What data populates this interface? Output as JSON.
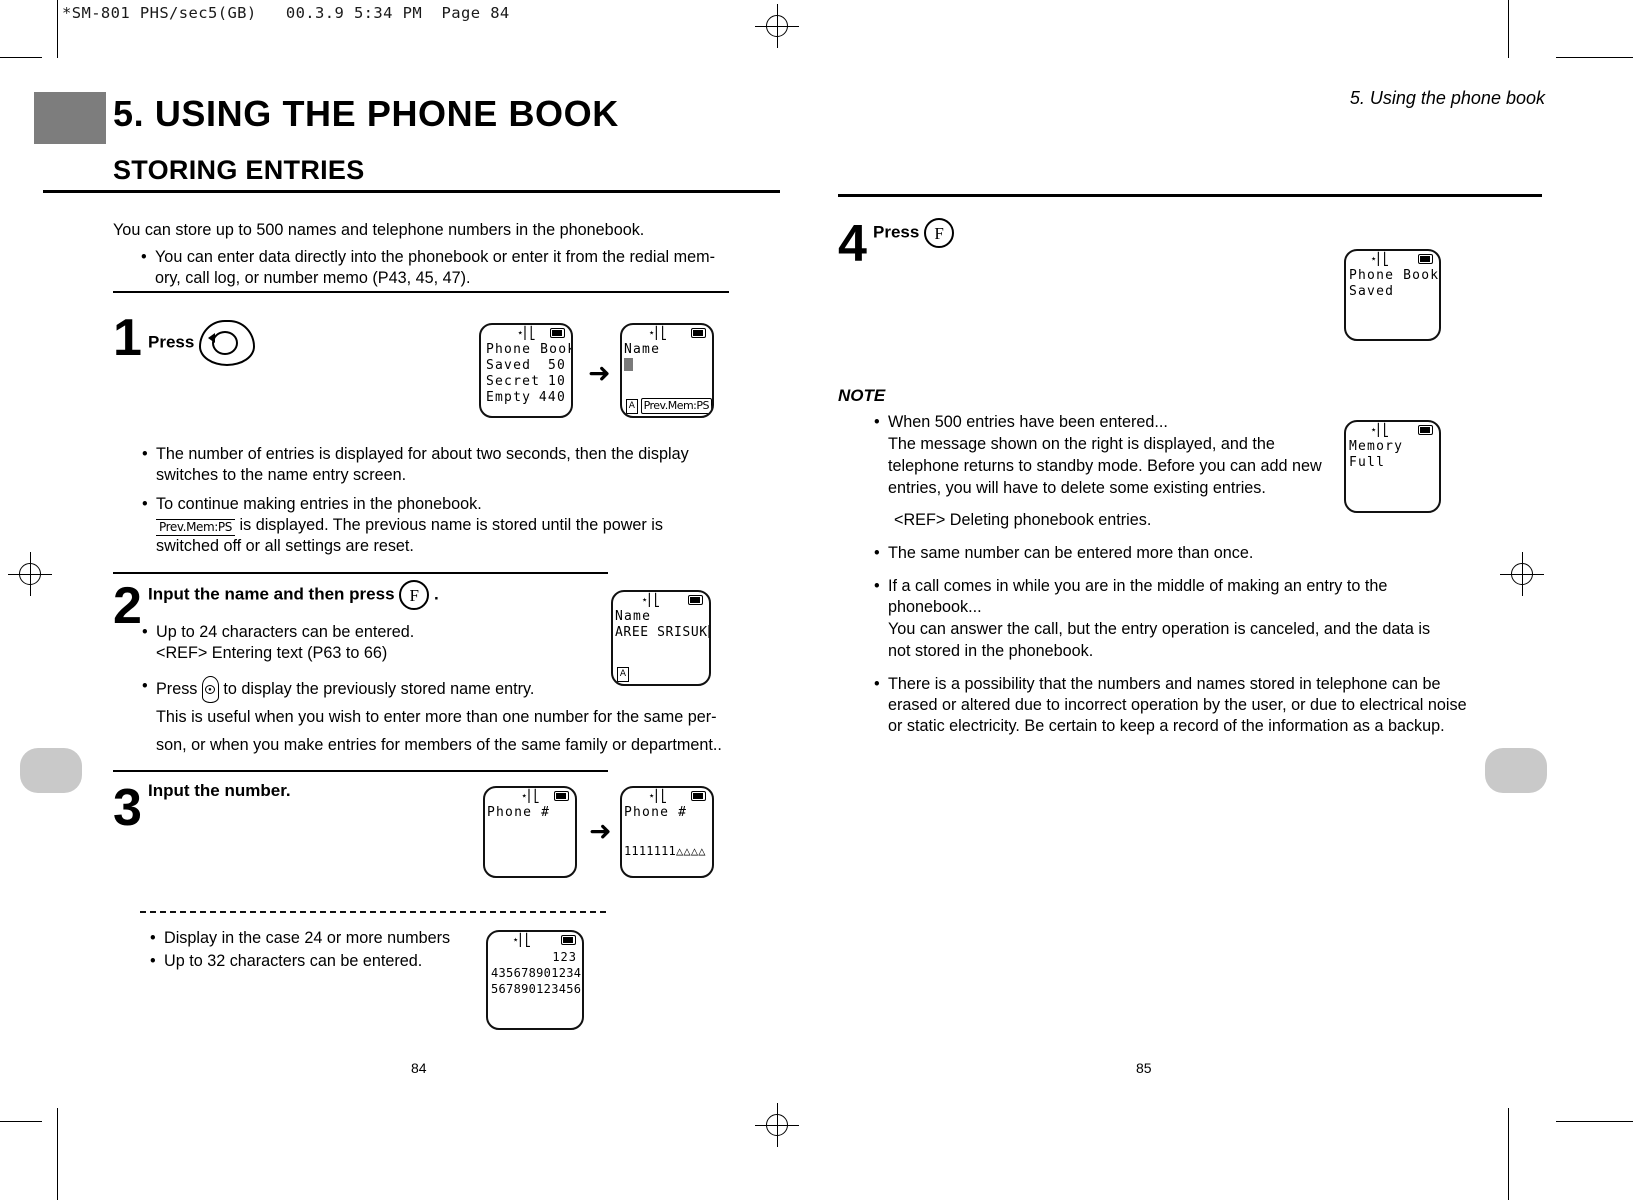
{
  "slug": "*SM-801 PHS/sec5(GB)   00.3.9 5:34 PM  Page 84",
  "chapter_title": "5. USING THE PHONE BOOK",
  "section_title": "STORING ENTRIES",
  "running_head": "5. Using the phone book",
  "folio_left": "84",
  "folio_right": "85",
  "intro": {
    "lead": "You can store up to 500 names and telephone numbers in the phonebook.",
    "bullet": "You can enter data directly into the phonebook or enter it from the redial mem-ory, call log, or number memo (P43, 45, 47)."
  },
  "steps": [
    {
      "number": "1",
      "label": "Press",
      "key": "power-oval-key",
      "notes": [
        {
          "text": "The number of entries is displayed for about two seconds, then the display switches to the name entry screen.",
          "bold": false
        },
        {
          "text": "To continue making entries in the phonebook.",
          "bold": true
        },
        {
          "text": "is displayed. The previous name is stored until the power is switched off or all settings are reset.",
          "bold": false,
          "chip": "Prev.Mem:PS"
        }
      ]
    },
    {
      "number": "2",
      "label": "Input the name and then press",
      "label_tail": ".",
      "key": "F",
      "notes": [
        {
          "text": "Up to 24 characters can be entered.",
          "bold": false
        },
        {
          "text": "<REF> Entering text (P63 to 66)",
          "bold": false
        },
        {
          "text": "Press",
          "text2": "to display the previously stored name entry.",
          "bold": true
        },
        {
          "text": "This is useful when you wish to enter more than one number for the same per-",
          "bold": false
        },
        {
          "text": "son, or when you make entries for members of the same family or department..",
          "bold": false
        }
      ]
    },
    {
      "number": "3",
      "label": "Input the number.",
      "notes": [
        {
          "text": "Display in the case 24 or more numbers",
          "bold": true
        },
        {
          "text": "Up to 32 characters can be entered.",
          "bold": false
        }
      ]
    },
    {
      "number": "4",
      "label": "Press",
      "key": "F"
    }
  ],
  "lcds": {
    "phonebook_counts": {
      "title": "Phone Book",
      "rows": [
        {
          "label": "Saved",
          "value": "50"
        },
        {
          "label": "Secret",
          "value": "10"
        },
        {
          "label": "Empty",
          "value": "440"
        }
      ]
    },
    "name_empty": {
      "title": "Name",
      "value": "",
      "softkey": "Prev.Mem:PS",
      "ime": "A"
    },
    "name_filled": {
      "title": "Name",
      "value": "AREE SRISUK",
      "ime": "A"
    },
    "phone_empty": {
      "title": "Phone #",
      "value": ""
    },
    "phone_filled": {
      "title": "Phone #",
      "value": "1111111△△△△"
    },
    "long_number": {
      "line1": "123",
      "line2": "435678901234",
      "line3": "567890123456"
    },
    "saved": {
      "line1": "Phone Book",
      "line2": "Saved"
    },
    "memory_full": {
      "line1": "Memory",
      "line2": "Full"
    }
  },
  "note": {
    "heading": "NOTE",
    "items": [
      {
        "bold_head": "When 500 entries have been entered...",
        "body": "The message shown on the right is displayed, and the telephone returns to standby mode. Before you can add new entries, you will have to delete some existing entries.",
        "ref": "<REF> Deleting phonebook entries."
      },
      {
        "bold_head": "",
        "body": "The same number can be entered more than once."
      },
      {
        "bold_head": "If a call comes in while you are in the middle of making an entry to the phonebook...",
        "body": "You can answer the call, but the entry operation is canceled, and the data is not stored in the phonebook."
      },
      {
        "bold_head": "",
        "body": "There is a possibility that the numbers and names stored in telephone can be erased or altered due to incorrect operation by the user, or due to electrical noise or static electricity. Be certain to keep a record of the information as a backup."
      }
    ]
  },
  "colors": {
    "chapter_block": "#7d7d7d",
    "tab_grey": "#c9c9c9",
    "ink": "#000000"
  }
}
